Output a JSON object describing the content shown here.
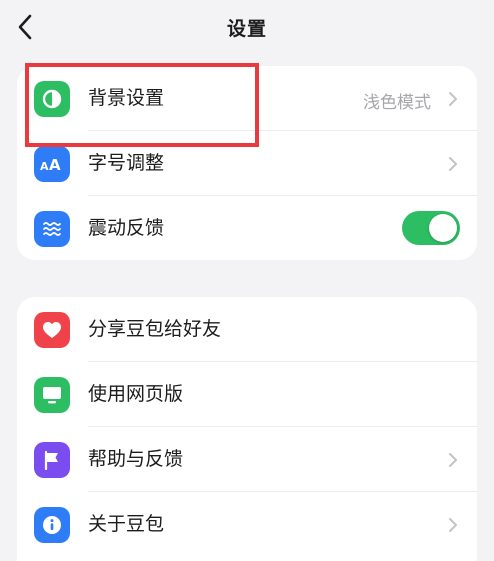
{
  "header": {
    "title": "设置"
  },
  "section1": {
    "items": [
      {
        "label": "背景设置",
        "value": "浅色模式",
        "icon": "contrast-icon",
        "icon_bg": "#2dbd63"
      },
      {
        "label": "字号调整",
        "icon": "font-size-icon",
        "icon_bg": "#2f7df6"
      },
      {
        "label": "震动反馈",
        "icon": "vibration-icon",
        "icon_bg": "#2f7df6",
        "toggle_on": true
      }
    ]
  },
  "section2": {
    "items": [
      {
        "label": "分享豆包给好友",
        "icon": "heart-icon",
        "icon_bg": "#f0424a"
      },
      {
        "label": "使用网页版",
        "icon": "monitor-icon",
        "icon_bg": "#2dbd63"
      },
      {
        "label": "帮助与反馈",
        "icon": "flag-icon",
        "icon_bg": "#7b4cf0"
      },
      {
        "label": "关于豆包",
        "icon": "info-icon",
        "icon_bg": "#2f7df6"
      }
    ]
  },
  "colors": {
    "toggle_on": "#2dbd63",
    "highlight": "#ea3a3f",
    "background": "#f3f3f5"
  }
}
